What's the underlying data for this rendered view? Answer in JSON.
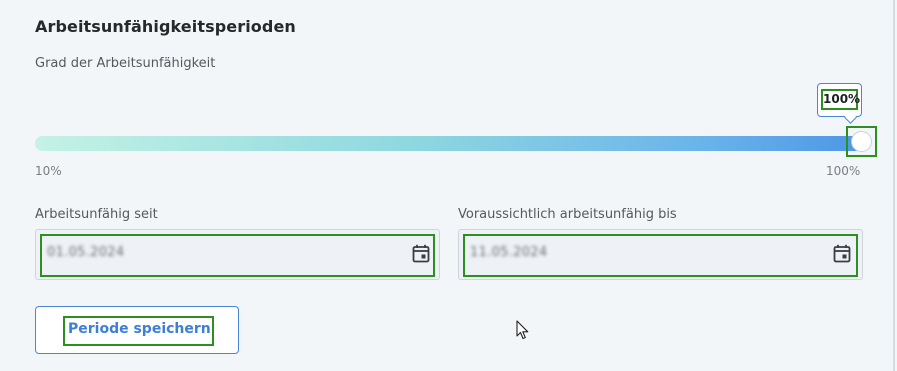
{
  "section": {
    "title": "Arbeitsunfähigkeitsperioden"
  },
  "slider": {
    "label": "Grad der Arbeitsunfähigkeit",
    "value": 100,
    "value_label": "100%",
    "min_label": "10%",
    "max_label": "100%",
    "min": 10,
    "max": 100
  },
  "fields": {
    "start": {
      "label": "Arbeitsunfähig seit",
      "value": "01.05.2024",
      "icon": "calendar-icon"
    },
    "end": {
      "label": "Voraussichtlich arbeitsunfähig bis",
      "value": "11.05.2024",
      "icon": "calendar-icon"
    }
  },
  "actions": {
    "save_label": "Periode speichern"
  },
  "colors": {
    "accent": "#4a86d8",
    "highlight": "#2d8f1f",
    "gradient_start": "#c4f2e4",
    "gradient_end": "#4d97e6"
  }
}
